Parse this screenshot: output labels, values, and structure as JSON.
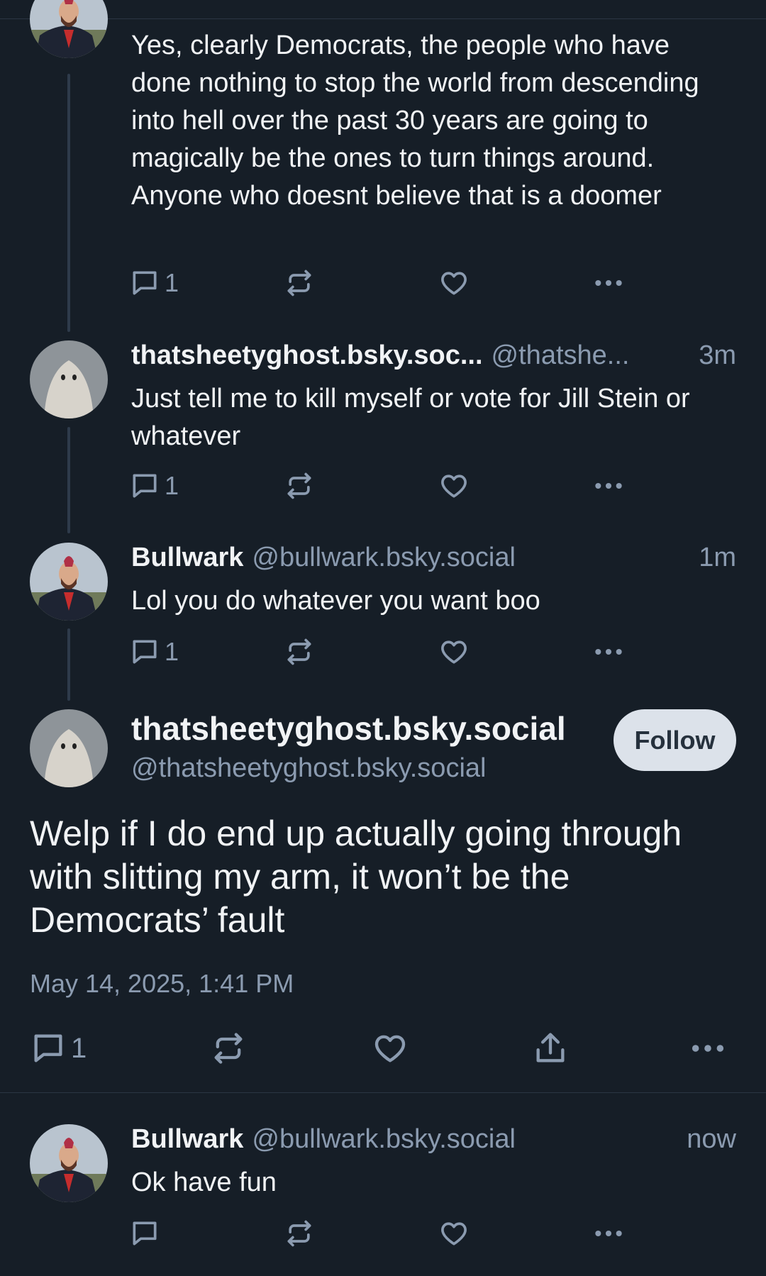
{
  "posts": [
    {
      "text": "Yes, clearly Democrats, the people who have done nothing to stop the world from descending into hell over the past 30 years are going to magically be the ones to turn things around. Anyone who doesnt believe that is a doomer",
      "reply_count": "1"
    },
    {
      "author": "thatsheetyghost.bsky.soc...",
      "handle": "@thatshe...",
      "time": "3m",
      "text": "Just tell me to kill myself or vote for Jill Stein or whatever",
      "reply_count": "1"
    },
    {
      "author": "Bullwark",
      "handle": "@bullwark.bsky.social",
      "time": "1m",
      "text": "Lol you do whatever you want boo",
      "reply_count": "1"
    }
  ],
  "focused_post": {
    "author": "thatsheetyghost.bsky.social",
    "handle": "@thatsheetyghost.bsky.social",
    "follow_label": "Follow",
    "text": "Welp if I do end up actually going through with slitting my arm, it won’t be the Democrats’ fault",
    "date": "May 14, 2025, 1:41 PM",
    "reply_count": "1"
  },
  "reply": {
    "author": "Bullwark",
    "handle": "@bullwark.bsky.social",
    "time": "now",
    "text": "Ok have fun"
  },
  "icons": {
    "reply": "speech-bubble-icon",
    "repost": "repost-arrows-icon",
    "like": "heart-icon",
    "share": "share-upload-icon",
    "more": "ellipsis-icon"
  },
  "colors": {
    "background": "#161e27",
    "text": "#f1f3f5",
    "muted": "#8b9bb0",
    "follow_button": "#dce2ea"
  }
}
